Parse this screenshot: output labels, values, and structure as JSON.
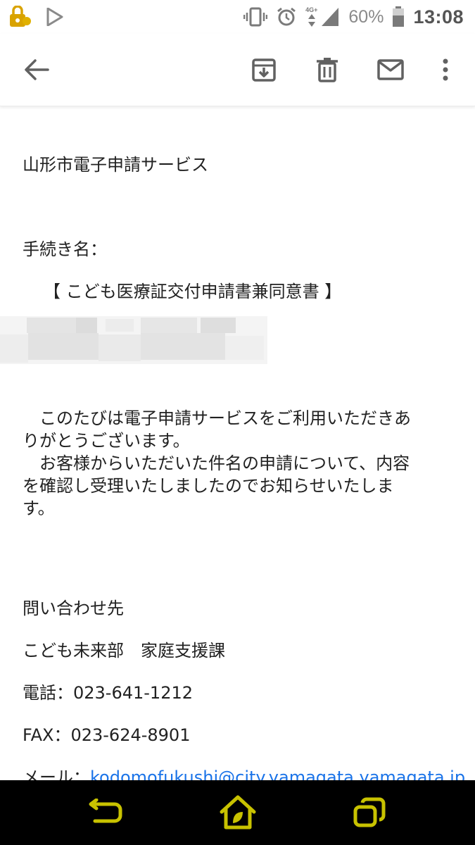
{
  "status_bar": {
    "network_type": "4G+",
    "battery_percent": "60%",
    "time": "13:08"
  },
  "toolbar": {
    "back_icon": "arrow-back-icon",
    "archive_icon": "archive-icon",
    "delete_icon": "trash-icon",
    "mark_unread_icon": "mail-icon",
    "more_icon": "more-vert-icon"
  },
  "email": {
    "service_name": "山形市電子申請サービス",
    "procedure_label": "手続き名：",
    "procedure_name": "【 こども医療証交付申請書兼同意書 】",
    "body_lines": [
      "　このたびは電子申請サービスをご利用いただきあ",
      "りがとうございます。",
      "　お客様からいただいた件名の申請について、内容",
      "を確認し受理いたしましたのでお知らせいたしま",
      "す。"
    ],
    "contact_heading": "問い合わせ先",
    "department": "こども未来部　家庭支援課",
    "phone": "電話：023-641-1212",
    "fax": "FAX：023-624-8901",
    "mail_label": "メール：",
    "mail_address": "kodomofukushi@city.yamagata.yamagata.jp"
  },
  "nav_bar": {
    "back_icon": "nav-back-icon",
    "home_icon": "nav-home-icon",
    "recents_icon": "nav-recents-icon",
    "accent_color": "#c8c200"
  }
}
